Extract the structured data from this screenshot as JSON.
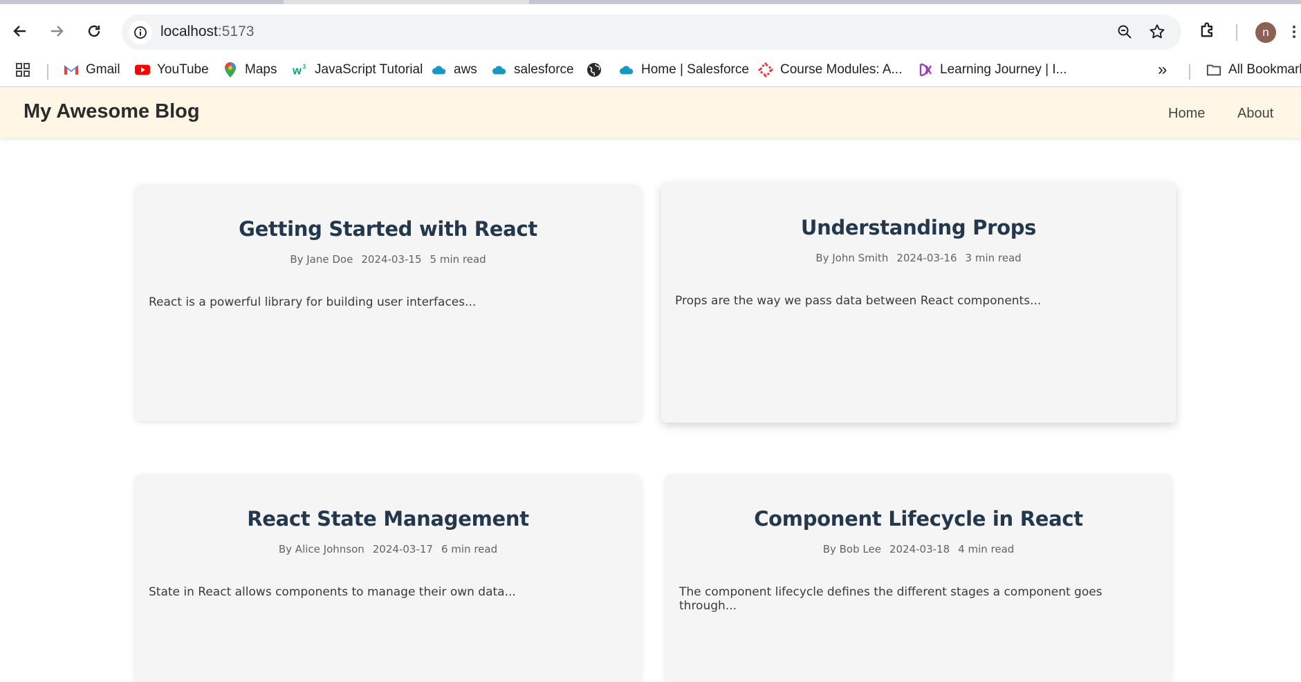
{
  "browser": {
    "url_host": "localhost",
    "url_port": ":5173",
    "avatar_initial": "n"
  },
  "bookmarks": {
    "items": [
      {
        "label": "Gmail",
        "icon": "gmail-icon"
      },
      {
        "label": "YouTube",
        "icon": "youtube-icon"
      },
      {
        "label": "Maps",
        "icon": "maps-icon"
      },
      {
        "label": "JavaScript Tutorial",
        "icon": "w3schools-icon"
      },
      {
        "label": "aws",
        "icon": "cloud-icon"
      },
      {
        "label": "salesforce",
        "icon": "cloud-icon"
      },
      {
        "label": "",
        "icon": "globe-icon"
      },
      {
        "label": "Home | Salesforce",
        "icon": "cloud-icon"
      },
      {
        "label": "Course Modules: A...",
        "icon": "canvas-icon"
      },
      {
        "label": "Learning Journey | I...",
        "icon": "learning-icon"
      }
    ],
    "overflow": "»",
    "all_bookmarks": "All Bookmarks"
  },
  "app": {
    "title": "My Awesome Blog",
    "nav": [
      "Home",
      "About"
    ]
  },
  "posts": [
    {
      "title": "Getting Started with React",
      "author": "By Jane Doe",
      "date": "2024-03-15",
      "read_time": "5 min read",
      "excerpt": "React is a powerful library for building user interfaces..."
    },
    {
      "title": "Understanding Props",
      "author": "By John Smith",
      "date": "2024-03-16",
      "read_time": "3 min read",
      "excerpt": "Props are the way we pass data between React components..."
    },
    {
      "title": "React State Management",
      "author": "By Alice Johnson",
      "date": "2024-03-17",
      "read_time": "6 min read",
      "excerpt": "State in React allows components to manage their own data..."
    },
    {
      "title": "Component Lifecycle in React",
      "author": "By Bob Lee",
      "date": "2024-03-18",
      "read_time": "4 min read",
      "excerpt": "The component lifecycle defines the different stages a component goes through..."
    }
  ],
  "colors": {
    "header_bg": "#fff6e6",
    "card_bg": "#f5f5f5",
    "title_color": "#23384d"
  }
}
